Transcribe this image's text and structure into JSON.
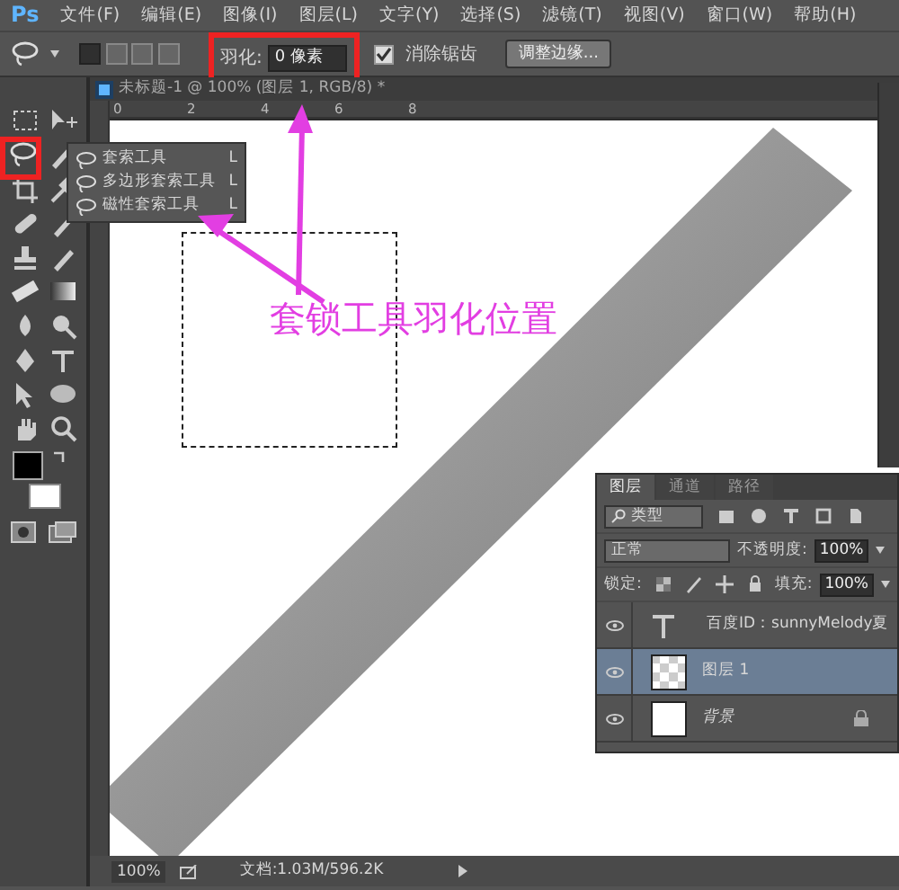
{
  "menu_bar": {
    "logo": "Ps",
    "items": [
      "文件(F)",
      "编辑(E)",
      "图像(I)",
      "图层(L)",
      "文字(Y)",
      "选择(S)",
      "滤镜(T)",
      "视图(V)",
      "窗口(W)",
      "帮助(H)"
    ]
  },
  "options_bar": {
    "selection_modes": [
      {
        "selected": true
      },
      {
        "selected": false
      },
      {
        "selected": false
      },
      {
        "selected": false
      }
    ],
    "feather_label": "羽化:",
    "feather_value": "0 像素",
    "anti_alias": {
      "label": "消除锯齿",
      "checked": true
    },
    "refine_button": "调整边缘..."
  },
  "document_tab": {
    "title": "未标题-1 @ 100% (图层 1, RGB/8) *"
  },
  "ruler_labels": [
    "0",
    "2",
    "4",
    "6",
    "8"
  ],
  "tools_flyout": {
    "items": [
      {
        "label": "套索工具",
        "shortcut": "L"
      },
      {
        "label": "多边形套索工具",
        "shortcut": "L"
      },
      {
        "label": "磁性套索工具",
        "shortcut": "L"
      }
    ]
  },
  "annotation": {
    "text": "套锁工具羽化位置"
  },
  "layers_panel": {
    "tabs": [
      {
        "label": "图层",
        "selected": true
      },
      {
        "label": "通道",
        "selected": false
      },
      {
        "label": "路径",
        "selected": false
      }
    ],
    "filter": "类型",
    "blend_mode": "正常",
    "opacity_label": "不透明度:",
    "opacity": "100%",
    "lock_label": "锁定:",
    "fill_label": "填充:",
    "fill": "100%",
    "layers": [
      {
        "kind": "text",
        "name": "百度ID：sunnyMelody夏",
        "selected": false
      },
      {
        "kind": "transparent",
        "name": "图层 1",
        "selected": true
      },
      {
        "kind": "background",
        "name": "背景",
        "selected": false
      }
    ]
  },
  "status_bar": {
    "zoom": "100%",
    "doc_info": "文档:1.03M/596.2K"
  }
}
